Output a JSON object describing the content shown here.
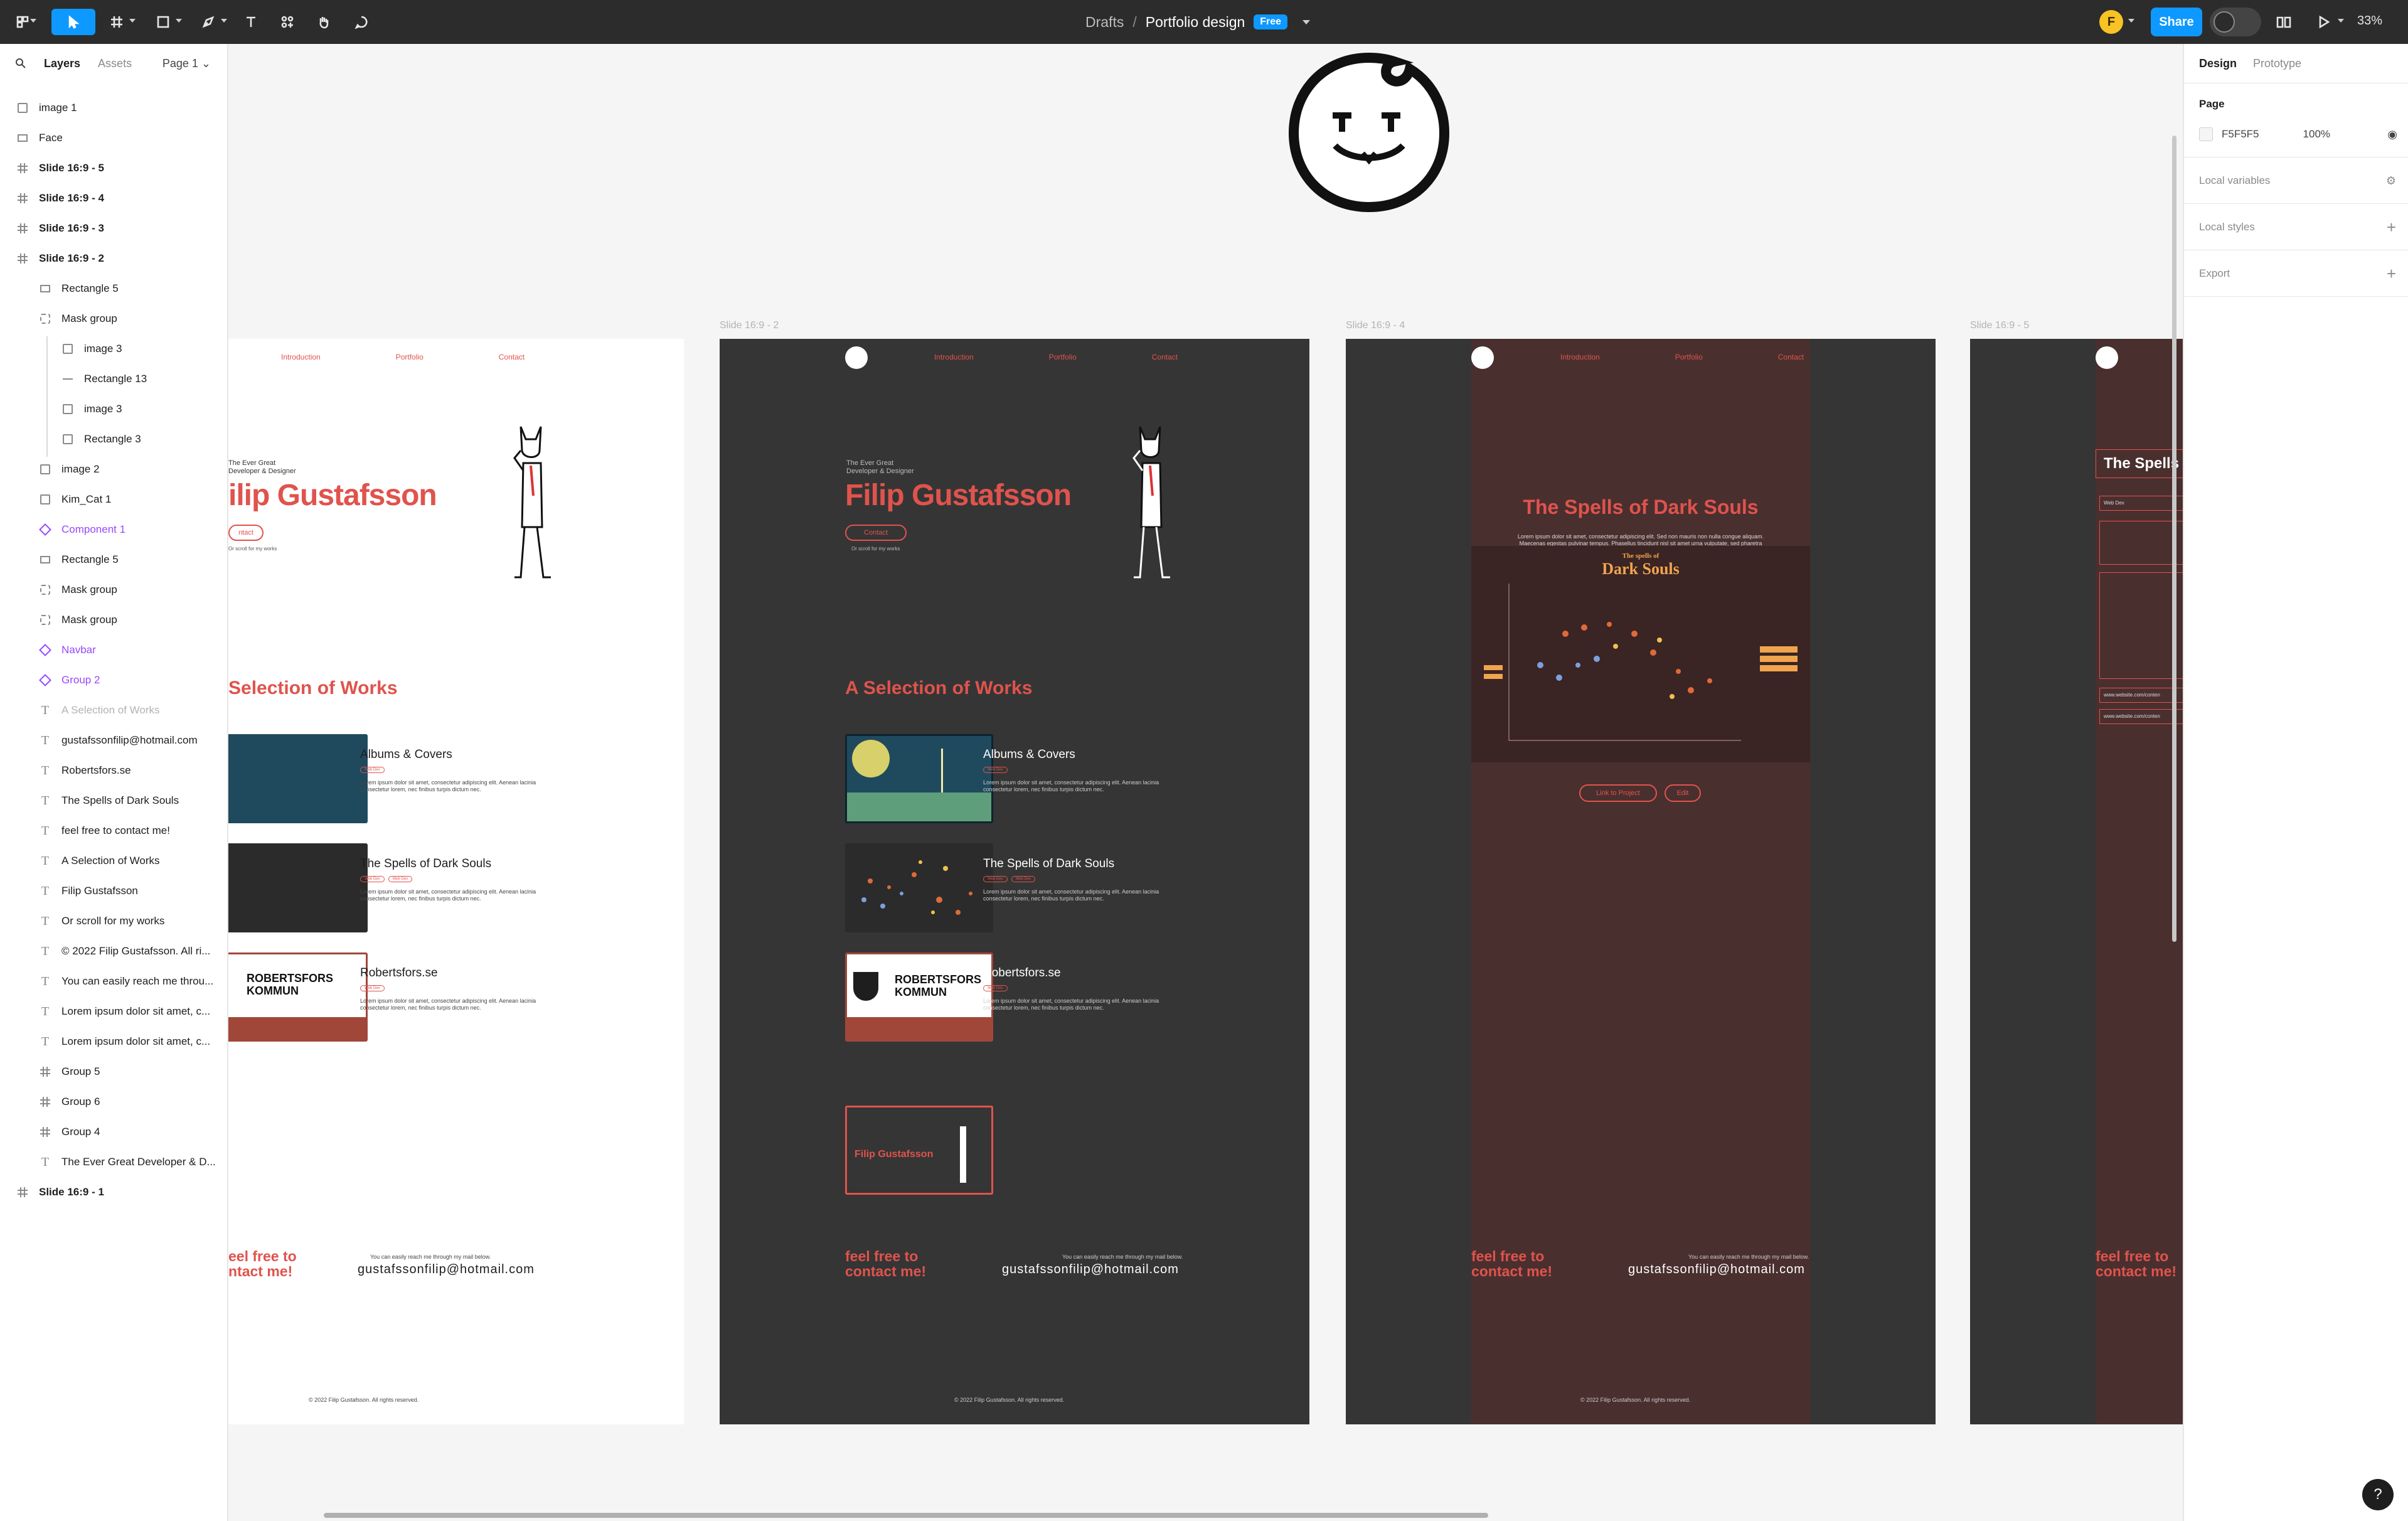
{
  "toolbar": {
    "breadcrumb_drafts": "Drafts",
    "breadcrumb_sep": "/",
    "file_title": "Portfolio design",
    "plan_badge": "Free",
    "avatar_initial": "F",
    "share_label": "Share",
    "zoom": "33%"
  },
  "left_panel": {
    "tab_layers": "Layers",
    "tab_assets": "Assets",
    "page_select": "Page 1",
    "layers": [
      {
        "label": "image 1",
        "icon": "image-icon"
      },
      {
        "label": "Face",
        "icon": "rectangle-icon"
      },
      {
        "label": "Slide 16:9 - 5",
        "icon": "frame-icon"
      },
      {
        "label": "Slide 16:9 - 4",
        "icon": "frame-icon"
      },
      {
        "label": "Slide 16:9 - 3",
        "icon": "frame-icon"
      },
      {
        "label": "Slide 16:9 - 2",
        "icon": "frame-icon"
      },
      {
        "label": "Rectangle 5",
        "icon": "rectangle-icon"
      },
      {
        "label": "Mask group",
        "icon": "mask-icon"
      },
      {
        "label": "image 3",
        "icon": "image-icon"
      },
      {
        "label": "Rectangle 13",
        "icon": "line-icon"
      },
      {
        "label": "image 3",
        "icon": "image-icon"
      },
      {
        "label": "Rectangle 3",
        "icon": "half-circle-icon"
      },
      {
        "label": "image 2",
        "icon": "image-icon"
      },
      {
        "label": "Kim_Cat 1",
        "icon": "image-icon"
      },
      {
        "label": "Component 1",
        "icon": "component-icon"
      },
      {
        "label": "Rectangle 5",
        "icon": "rectangle-icon"
      },
      {
        "label": "Mask group",
        "icon": "mask-icon"
      },
      {
        "label": "Mask group",
        "icon": "mask-icon"
      },
      {
        "label": "Navbar",
        "icon": "component-icon"
      },
      {
        "label": "Group 2",
        "icon": "component-icon"
      },
      {
        "label": "A Selection of Works",
        "icon": "text-icon"
      },
      {
        "label": "gustafssonfilip@hotmail.com",
        "icon": "text-icon"
      },
      {
        "label": "Robertsfors.se",
        "icon": "text-icon"
      },
      {
        "label": "The Spells of Dark Souls",
        "icon": "text-icon"
      },
      {
        "label": "feel free to contact me!",
        "icon": "text-icon"
      },
      {
        "label": "A Selection of Works",
        "icon": "text-icon"
      },
      {
        "label": "Filip Gustafsson",
        "icon": "text-icon"
      },
      {
        "label": "Or scroll for my works",
        "icon": "text-icon"
      },
      {
        "label": "© 2022 Filip Gustafsson. All ri...",
        "icon": "text-icon"
      },
      {
        "label": "You can easily reach me throu...",
        "icon": "text-icon"
      },
      {
        "label": "Lorem ipsum dolor sit amet, c...",
        "icon": "text-icon"
      },
      {
        "label": "Lorem ipsum dolor sit amet, c...",
        "icon": "text-icon"
      },
      {
        "label": "Group 5",
        "icon": "frame-icon"
      },
      {
        "label": "Group 6",
        "icon": "frame-icon"
      },
      {
        "label": "Group 4",
        "icon": "frame-icon"
      },
      {
        "label": "The Ever Great Developer & D...",
        "icon": "text-icon"
      },
      {
        "label": "Slide 16:9 - 1",
        "icon": "frame-icon"
      }
    ]
  },
  "canvas": {
    "slide_labels": [
      "Slide 16:9 - 2",
      "Slide 16:9 - 4",
      "Slide 16:9 - 5"
    ],
    "nav": [
      "Introduction",
      "Portfolio",
      "Contact"
    ],
    "eyebrow_line1": "The Ever Great",
    "eyebrow_line2": "Developer & Designer",
    "name": "Filip Gustafsson",
    "name_cropped": "ilip Gustafsson",
    "contact_button": "Contact",
    "contact_button_cropped": "ntact",
    "scroll_hint": "Or scroll for my works",
    "section_title": "A Selection of Works",
    "section_title_cropped": "Selection of Works",
    "works": [
      {
        "title": "Albums & Covers",
        "desc": "Lorem ipsum dolor sit amet, consectetur adipiscing elit. Aenean lacinia consectetur lorem, nec finibus turpis dictum nec.",
        "tags": [
          "Web Dev"
        ]
      },
      {
        "title": "The Spells of Dark Souls",
        "desc": "Lorem ipsum dolor sit amet, consectetur adipiscing elit. Aenean lacinia consectetur lorem, nec finibus turpis dictum nec.",
        "tags": [
          "Web Dev",
          "Web Dev"
        ]
      },
      {
        "title": "Robertsfors.se",
        "desc": "Lorem ipsum dolor sit amet, consectetur adipiscing elit. Aenean lacinia consectetur lorem, nec finibus turpis dictum nec.",
        "tags": [
          "Web Dev"
        ]
      }
    ],
    "robertsfors_logo_text": "ROBERTSFORS KOMMUN",
    "feel_free_1": "feel free to",
    "feel_free_2": "contact me!",
    "feel_free_cropped_1": "eel free to",
    "feel_free_cropped_2": "ntact me!",
    "reach_text": "You can easily reach me through my mail below.",
    "email": "gustafssonfilip@hotmail.com",
    "copyright": "© 2022 Filip Gustafsson. All rights reserved.",
    "ds_title": "The Spells of Dark Souls",
    "ds_title_cropped": "The Spells o",
    "ds_lorem": "Lorem ipsum dolor sit amet, consectetur adipiscing elit. Sed non mauris non nulla congue aliquam. Maecenas egestas pulvinar tempus. Phasellus tincidunt nisl sit amet urna vulputate, sed pharetra neque. Integer nec pulvinar elementum, ultricies quam id, porta turpis. Mauris dapibus urna id ante viverra, in hendrerit neque commodo. Aenean non nisl a odio malesuada euismod nec in tortor. Nam erat arcu, aliquet non mattis vulputate, pulvinar vitae lorem.",
    "ds_viz_small": "The spells of",
    "ds_viz_big": "Dark Souls",
    "ds_link_button": "Link to Project",
    "ds_edit_button": "Edit",
    "slide5_tag": "Web Dev",
    "slide5_link1": "www.website.com/conten",
    "slide5_link2": "www.website.com/conten"
  },
  "right_panel": {
    "tab_design": "Design",
    "tab_prototype": "Prototype",
    "page_heading": "Page",
    "page_color": "F5F5F5",
    "page_opacity": "100%",
    "local_variables": "Local variables",
    "local_styles": "Local styles",
    "export": "Export"
  },
  "help_label": "?",
  "colors": {
    "accent": "#0d99ff",
    "brand_red": "#e0534d",
    "dark_slide": "#353535",
    "brown_slide": "#4a2f2f",
    "component_purple": "#9747ff"
  }
}
